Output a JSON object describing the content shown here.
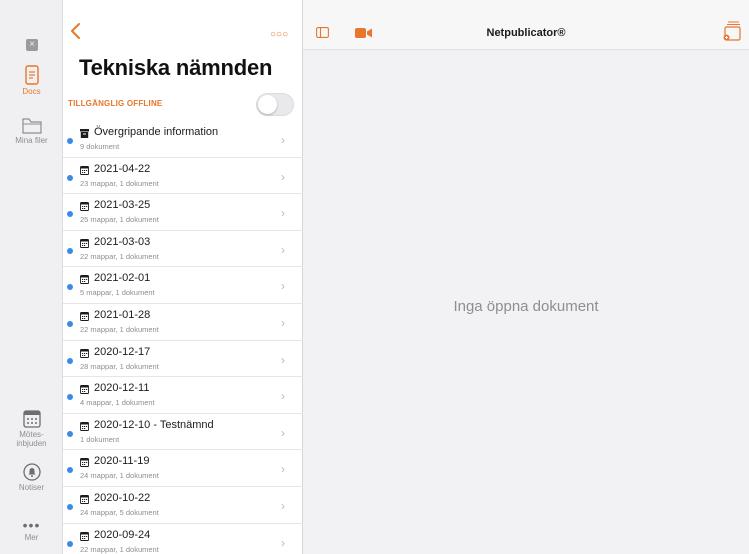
{
  "rail": {
    "items": [
      {
        "label": "Docs",
        "icon": "document-icon",
        "active": true
      },
      {
        "label": "Mina filer",
        "icon": "folder-icon",
        "active": false
      },
      {
        "label": "Mötes-\ninbjuden",
        "icon": "calendar-icon",
        "active": false
      },
      {
        "label": "Notiser",
        "icon": "bell-icon",
        "active": false
      },
      {
        "label": "Mer",
        "icon": "more-icon",
        "active": false
      }
    ]
  },
  "panel": {
    "title": "Tekniska nämnden",
    "offline_label": "TILLGÄNGLIG OFFLINE",
    "offline_enabled": false,
    "items": [
      {
        "title": "Övergripande information",
        "subtitle": "9 dokument",
        "icon": "archive-icon"
      },
      {
        "title": "2021-04-22",
        "subtitle": "23 mappar, 1 dokument",
        "icon": "calendar-icon"
      },
      {
        "title": "2021-03-25",
        "subtitle": "25 mappar, 1 dokument",
        "icon": "calendar-icon"
      },
      {
        "title": "2021-03-03",
        "subtitle": "22 mappar, 1 dokument",
        "icon": "calendar-icon"
      },
      {
        "title": "2021-02-01",
        "subtitle": "5 mappar, 1 dokument",
        "icon": "calendar-icon"
      },
      {
        "title": "2021-01-28",
        "subtitle": "22 mappar, 1 dokument",
        "icon": "calendar-icon"
      },
      {
        "title": "2020-12-17",
        "subtitle": "28 mappar, 1 dokument",
        "icon": "calendar-icon"
      },
      {
        "title": "2020-12-11",
        "subtitle": "4 mappar, 1 dokument",
        "icon": "calendar-icon"
      },
      {
        "title": "2020-12-10 - Testnämnd",
        "subtitle": "1 dokument",
        "icon": "calendar-icon"
      },
      {
        "title": "2020-11-19",
        "subtitle": "24 mappar, 1 dokument",
        "icon": "calendar-icon"
      },
      {
        "title": "2020-10-22",
        "subtitle": "24 mappar, 5 dokument",
        "icon": "calendar-icon"
      },
      {
        "title": "2020-09-24",
        "subtitle": "22 mappar, 1 dokument",
        "icon": "calendar-icon"
      }
    ]
  },
  "topbar": {
    "title": "Netpublicator®"
  },
  "main": {
    "empty_text": "Inga öppna dokument"
  },
  "colors": {
    "accent": "#e8762c",
    "unread_dot": "#3b8ae8"
  }
}
